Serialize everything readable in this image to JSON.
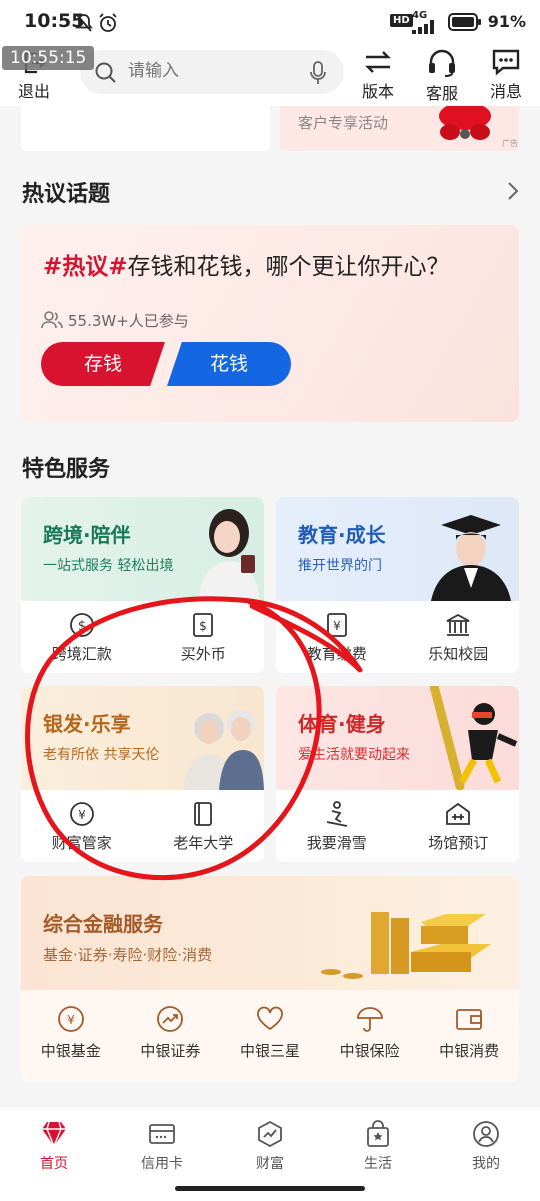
{
  "status_bar": {
    "time": "10:55",
    "network": "4G",
    "battery": "91%"
  },
  "overlay_timestamp": "10:55:15",
  "header": {
    "logout_label": "退出",
    "search_placeholder": "请输入",
    "version_label": "版本",
    "service_label": "客服",
    "message_label": "消息"
  },
  "promo": {
    "text": "客户专享活动",
    "ad_tag": "广告"
  },
  "hot_topics": {
    "title": "热议话题",
    "hashtag": "#热议#",
    "question": "存钱和花钱，哪个更让你开心？",
    "participants": "55.3W+人已参与",
    "option_save": "存钱",
    "option_spend": "花钱"
  },
  "featured": {
    "title": "特色服务",
    "cards": [
      {
        "title": "跨境·陪伴",
        "subtitle": "一站式服务 轻松出境",
        "items": [
          "跨境汇款",
          "买外币"
        ]
      },
      {
        "title": "教育·成长",
        "subtitle": "推开世界的门",
        "items": [
          "教育缴费",
          "乐知校园"
        ]
      },
      {
        "title": "银发·乐享",
        "subtitle": "老有所依 共享天伦",
        "items": [
          "财富管家",
          "老年大学"
        ]
      },
      {
        "title": "体育·健身",
        "subtitle": "爱生活就要动起来",
        "items": [
          "我要滑雪",
          "场馆预订"
        ]
      }
    ]
  },
  "financial": {
    "title": "综合金融服务",
    "subtitle": "基金·证券·寿险·财险·消费",
    "items": [
      "中银基金",
      "中银证券",
      "中银三星",
      "中银保险",
      "中银消费"
    ]
  },
  "bottom_nav": [
    "首页",
    "信用卡",
    "财富",
    "生活",
    "我的"
  ],
  "colors": {
    "brand_red": "#d8132f",
    "blue": "#1566e3",
    "annotation_red": "#e4161c"
  }
}
